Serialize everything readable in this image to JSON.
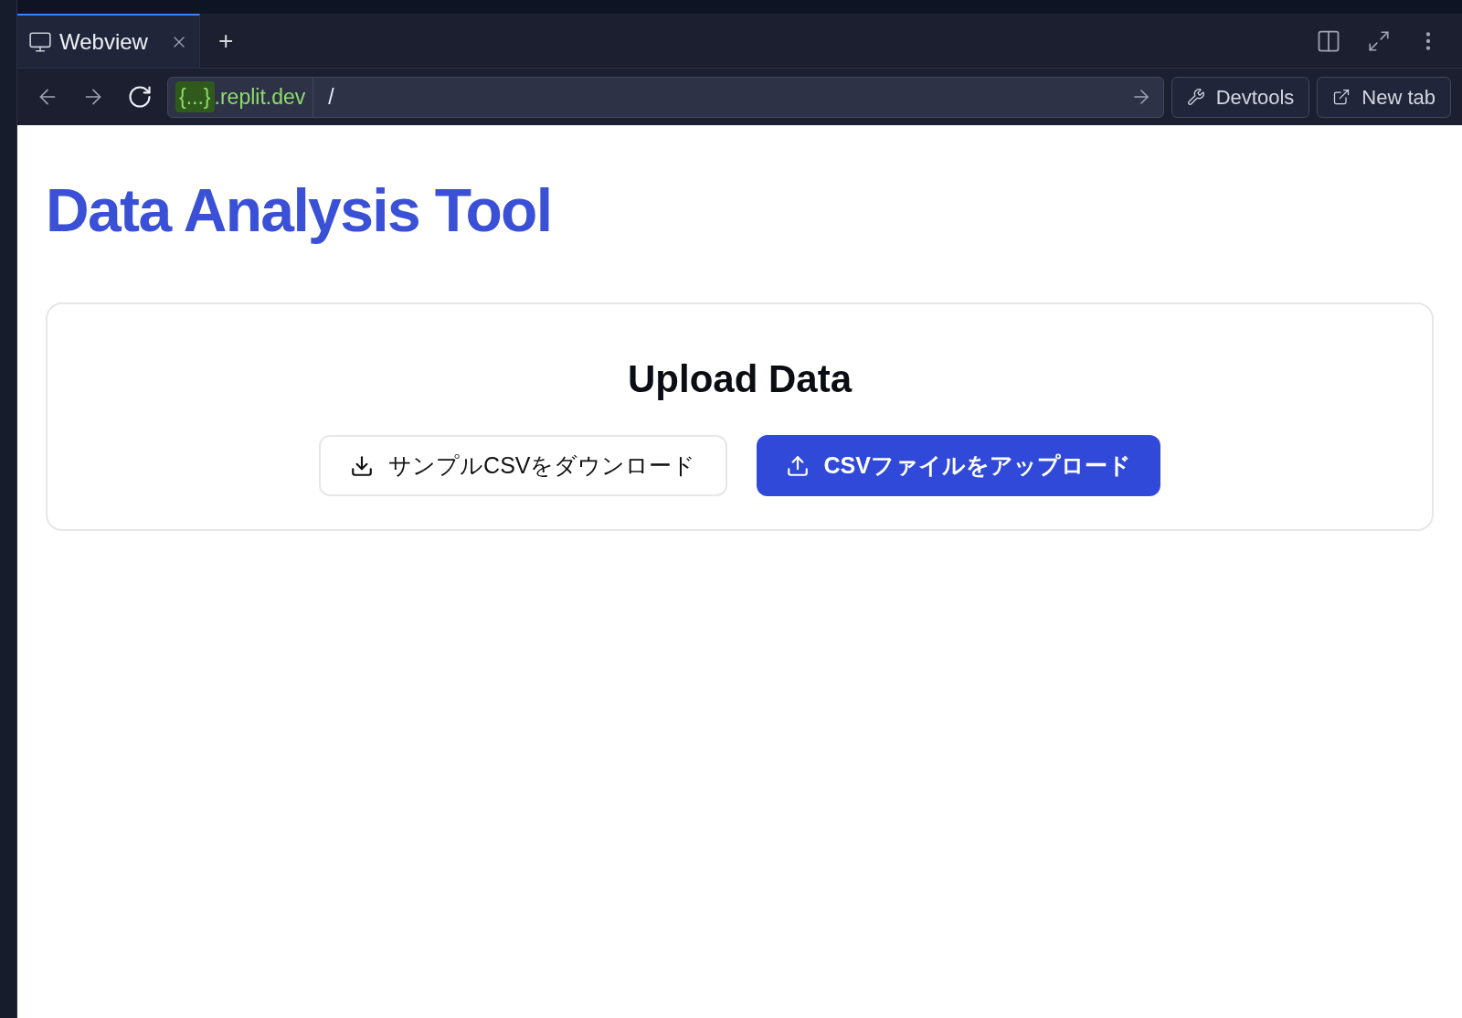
{
  "browser": {
    "tabs": [
      {
        "label": "Webview",
        "selected": true
      }
    ],
    "new_tab_symbol": "+",
    "address": {
      "host_badge": "{...}",
      "host": ".replit.dev",
      "path": "/"
    },
    "buttons": [
      "Devtools",
      "New tab"
    ]
  },
  "page": {
    "title": "Data Analysis Tool",
    "card": {
      "heading": "Upload Data",
      "buttons": [
        {
          "label": "サンプルCSVをダウンロード",
          "kind": "download"
        },
        {
          "label": "CSVファイルをアップロード",
          "kind": "upload"
        }
      ]
    }
  }
}
